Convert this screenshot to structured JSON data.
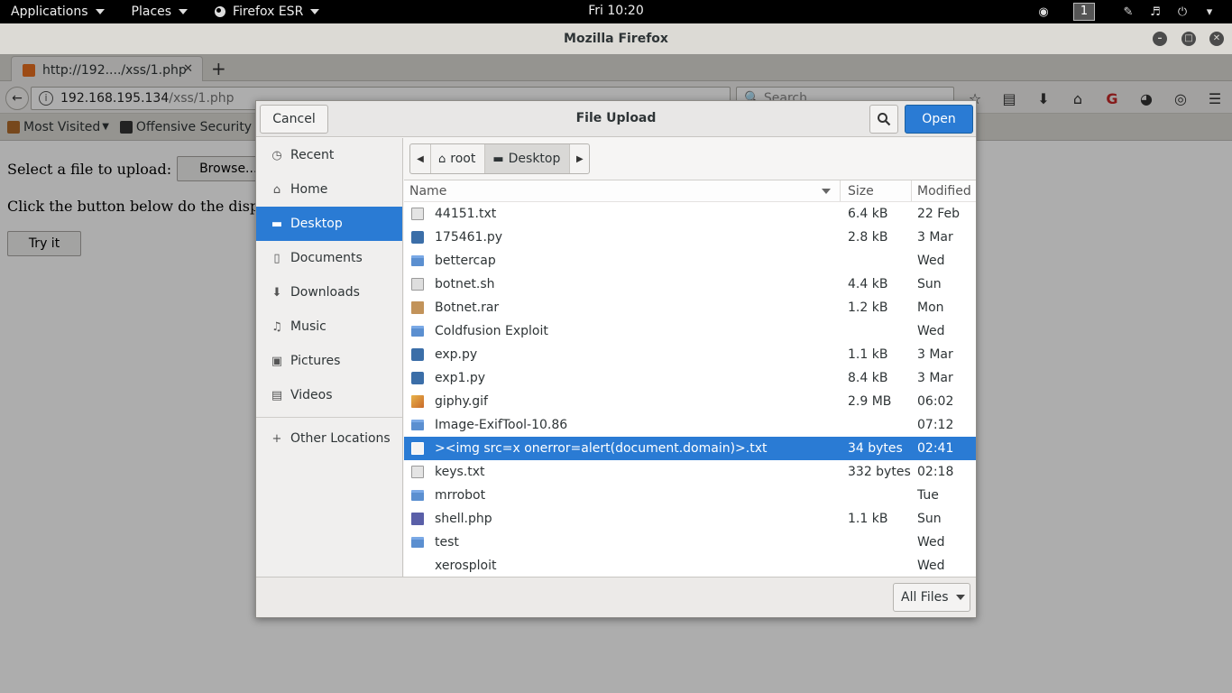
{
  "topbar": {
    "applications": "Applications",
    "places": "Places",
    "firefox": "Firefox ESR",
    "clock": "Fri 10:20",
    "workspace": "1"
  },
  "firefox": {
    "window_title": "Mozilla Firefox",
    "tab_title": "http://192..../xss/1.php",
    "url_host": "192.168.195.134",
    "url_path": "/xss/1.php",
    "search_placeholder": "Search",
    "bookmarks": [
      "Most Visited",
      "Offensive Security"
    ],
    "page": {
      "line1": "Select a file to upload:",
      "browse": "Browse...",
      "line2": "Click the button below do the disp",
      "try_it": "Try it"
    }
  },
  "dialog": {
    "title": "File Upload",
    "cancel": "Cancel",
    "open": "Open",
    "places": [
      {
        "label": "Recent",
        "icon": "clock-icon",
        "glyph": "◷"
      },
      {
        "label": "Home",
        "icon": "home-icon",
        "glyph": "⌂"
      },
      {
        "label": "Desktop",
        "icon": "folder-icon",
        "glyph": "▬"
      },
      {
        "label": "Documents",
        "icon": "document-icon",
        "glyph": "▯"
      },
      {
        "label": "Downloads",
        "icon": "download-icon",
        "glyph": "⬇"
      },
      {
        "label": "Music",
        "icon": "music-icon",
        "glyph": "♫"
      },
      {
        "label": "Pictures",
        "icon": "camera-icon",
        "glyph": "▣"
      },
      {
        "label": "Videos",
        "icon": "film-icon",
        "glyph": "▤"
      }
    ],
    "other_locations": "Other Locations",
    "path": {
      "root": "root",
      "current": "Desktop"
    },
    "columns": {
      "name": "Name",
      "size": "Size",
      "modified": "Modified"
    },
    "files": [
      {
        "name": "44151.txt",
        "size": "6.4 kB",
        "modified": "22 Feb",
        "type": "txt"
      },
      {
        "name": "175461.py",
        "size": "2.8 kB",
        "modified": "3 Mar",
        "type": "py"
      },
      {
        "name": "bettercap",
        "size": "",
        "modified": "Wed",
        "type": "folder"
      },
      {
        "name": "botnet.sh",
        "size": "4.4 kB",
        "modified": "Sun",
        "type": "sh"
      },
      {
        "name": "Botnet.rar",
        "size": "1.2 kB",
        "modified": "Mon",
        "type": "rar"
      },
      {
        "name": "Coldfusion Exploit",
        "size": "",
        "modified": "Wed",
        "type": "folder"
      },
      {
        "name": "exp.py",
        "size": "1.1 kB",
        "modified": "3 Mar",
        "type": "py"
      },
      {
        "name": "exp1.py",
        "size": "8.4 kB",
        "modified": "3 Mar",
        "type": "py"
      },
      {
        "name": "giphy.gif",
        "size": "2.9 MB",
        "modified": "06:02",
        "type": "gif"
      },
      {
        "name": "Image-ExifTool-10.86",
        "size": "",
        "modified": "07:12",
        "type": "folder"
      },
      {
        "name": "><img src=x onerror=alert(document.domain)>.txt",
        "size": "34 bytes",
        "modified": "02:41",
        "type": "txt",
        "selected": true
      },
      {
        "name": "keys.txt",
        "size": "332 bytes",
        "modified": "02:18",
        "type": "txt"
      },
      {
        "name": "mrrobot",
        "size": "",
        "modified": "Tue",
        "type": "folder"
      },
      {
        "name": "shell.php",
        "size": "1.1 kB",
        "modified": "Sun",
        "type": "php"
      },
      {
        "name": "test",
        "size": "",
        "modified": "Wed",
        "type": "folder"
      },
      {
        "name": "xerosploit",
        "size": "",
        "modified": "Wed",
        "type": "none"
      }
    ],
    "filter": "All Files",
    "colors": {
      "accent": "#2a7bd4"
    }
  }
}
